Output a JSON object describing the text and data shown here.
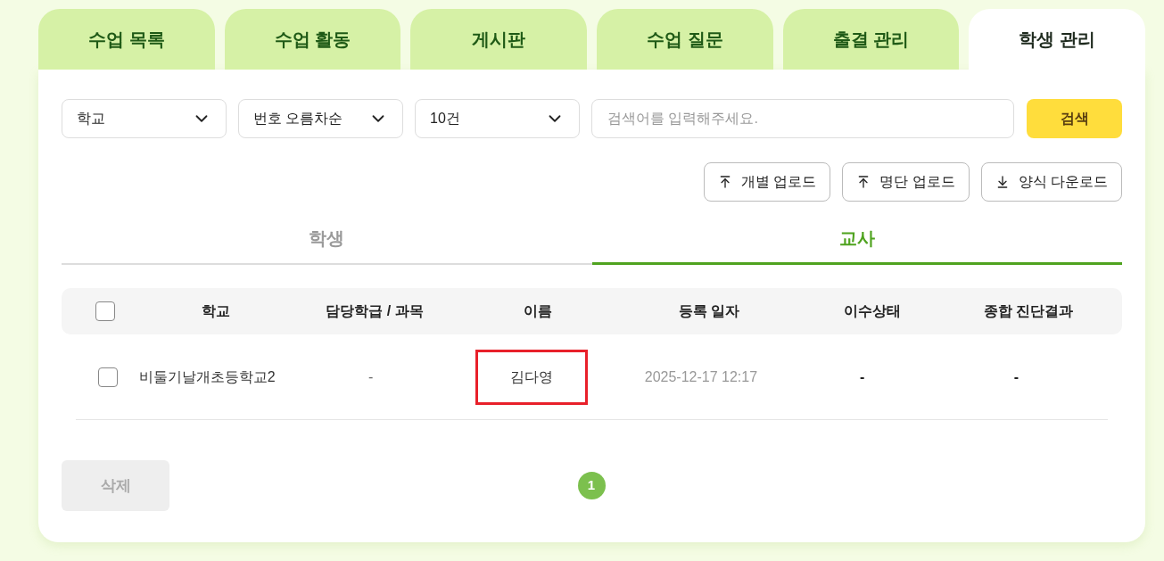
{
  "tabs": [
    {
      "label": "수업 목록",
      "selected": false
    },
    {
      "label": "수업 활동",
      "selected": false
    },
    {
      "label": "게시판",
      "selected": false
    },
    {
      "label": "수업 질문",
      "selected": false
    },
    {
      "label": "출결 관리",
      "selected": false
    },
    {
      "label": "학생 관리",
      "selected": true
    }
  ],
  "filters": [
    {
      "value": "학교"
    },
    {
      "value": "번호 오름차순"
    },
    {
      "value": "10건"
    }
  ],
  "search": {
    "placeholder": "검색어를 입력해주세요.",
    "button": "검색"
  },
  "actions": [
    {
      "label": "개별 업로드",
      "kind": "upload"
    },
    {
      "label": "명단 업로드",
      "kind": "upload"
    },
    {
      "label": "양식 다운로드",
      "kind": "download"
    }
  ],
  "subtabs": [
    {
      "label": "학생",
      "selected": false
    },
    {
      "label": "교사",
      "selected": true
    }
  ],
  "table": {
    "select_all_checked": false,
    "columns": [
      "학교",
      "담당학급 / 과목",
      "이름",
      "등록 일자",
      "이수상태",
      "종합 진단결과"
    ],
    "rows": [
      {
        "checked": false,
        "cells": [
          {
            "text": "비둘기날개초등학교2",
            "highlighted": false
          },
          {
            "text": "-",
            "highlighted": false
          },
          {
            "text": "김다영",
            "highlighted": true
          },
          {
            "text": "2025-12-17 12:17",
            "highlighted": false
          },
          {
            "text": "-",
            "highlighted": false
          },
          {
            "text": "-",
            "highlighted": false
          }
        ]
      }
    ]
  },
  "delete_button": {
    "label": "삭제",
    "disabled": true
  },
  "pagination": [
    {
      "label": "1",
      "selected": true
    }
  ]
}
